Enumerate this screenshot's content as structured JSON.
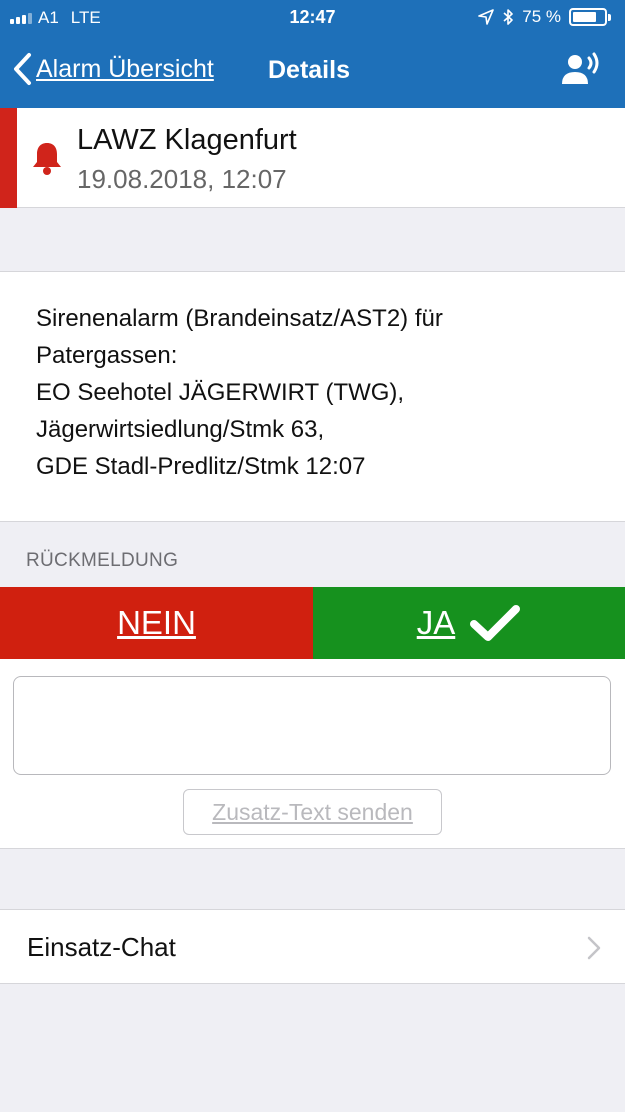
{
  "status_bar": {
    "carrier": "A1",
    "network": "LTE",
    "time": "12:47",
    "battery_text": "75 %",
    "battery_level": 0.75,
    "icons": [
      "signal-icon",
      "location-arrow-icon",
      "bluetooth-icon",
      "battery-icon"
    ]
  },
  "nav": {
    "back_label": "Alarm Übersicht",
    "title": "Details",
    "right_icon": "speaker-person-icon"
  },
  "alarm": {
    "title": "LAWZ Klagenfurt",
    "date": "19.08.2018, 12:07",
    "icon": "bell-icon",
    "accent_color": "#d0241b"
  },
  "message": {
    "lines": [
      "Sirenenalarm (Brandeinsatz/AST2) für",
      "Patergassen:",
      "EO Seehotel JÄGERWIRT (TWG),",
      "Jägerwirtsiedlung/Stmk 63,",
      "GDE Stadl-Predlitz/Stmk 12:07"
    ]
  },
  "feedback": {
    "section_label": "RÜCKMELDUNG",
    "no_label": "NEIN",
    "yes_label": "JA",
    "no_color": "#d0200f",
    "yes_color": "#16911e",
    "extra_text_value": "",
    "send_label": "Zusatz-Text senden"
  },
  "chat": {
    "label": "Einsatz-Chat",
    "icon": "chevron-right-icon"
  },
  "colors": {
    "nav_blue": "#1e70b9",
    "background": "#efeff4"
  }
}
